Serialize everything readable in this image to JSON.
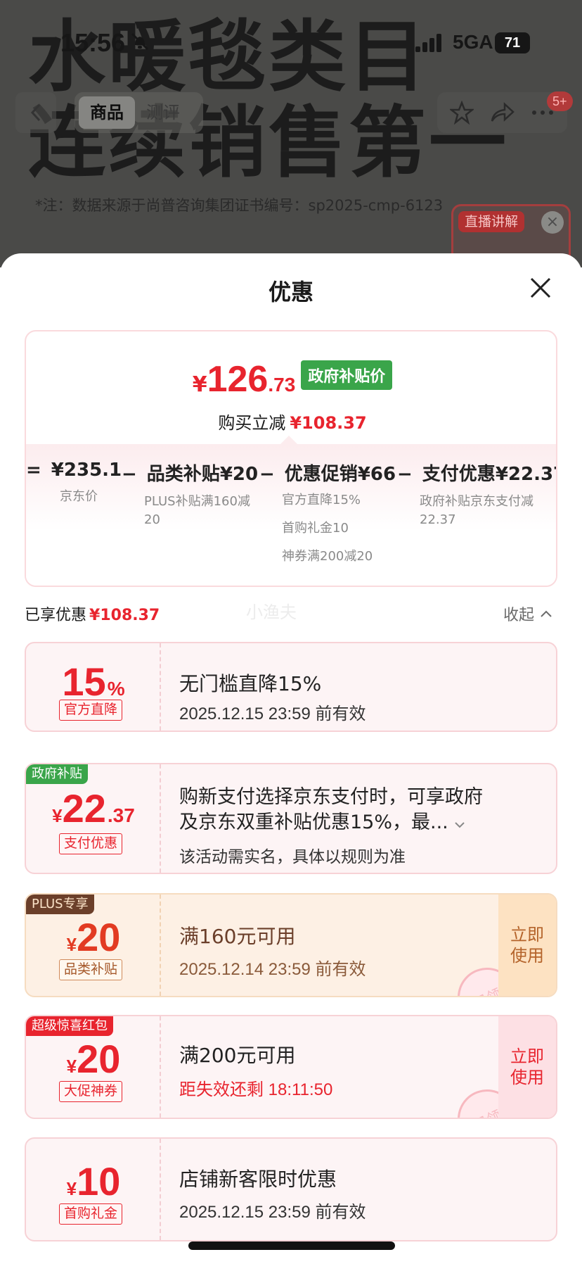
{
  "background": {
    "title_line1": "水暖毯类目",
    "title_line2": "连续销售第一",
    "note": "*注：数据来源于尚普咨询集团证书编号：sp2025-cmp-6123"
  },
  "status_bar": {
    "time": "15:56",
    "network": "5GA",
    "battery": "71"
  },
  "nav": {
    "tabs": [
      {
        "label": "商品"
      },
      {
        "label": "测评"
      }
    ],
    "badge": "5+"
  },
  "live": {
    "label": "直播讲解",
    "close": "×"
  },
  "sheet": {
    "title": "优惠"
  },
  "summary": {
    "currency": "¥",
    "price_int": "126",
    "price_dec": ".73",
    "price_tag": "政府补贴价",
    "instant_label": "购买立减",
    "instant_amount": "¥108.37",
    "formula": [
      {
        "op": "=",
        "amount": "¥235.1",
        "title": "",
        "desc": [
          "京东价"
        ]
      },
      {
        "op": "−",
        "amount": "¥20",
        "title": "品类补贴",
        "desc": [
          "PLUS补贴满160减20"
        ]
      },
      {
        "op": "−",
        "amount": "¥66",
        "title": "优惠促销",
        "desc": [
          "官方直降15%",
          "首购礼金10",
          "神券满200减20"
        ]
      },
      {
        "op": "−",
        "amount": "¥22.37",
        "title": "支付优惠",
        "desc": [
          "政府补贴京东支付减22.37"
        ]
      }
    ]
  },
  "enjoyed": {
    "label": "已享优惠",
    "amount": "¥108.37",
    "collapse": "收起",
    "watermark": "小渔夫"
  },
  "coupons": [
    {
      "corner": "",
      "cy": "",
      "num": "15",
      "suffix": "%",
      "tag": "官方直降",
      "main": "无门槛直降15%",
      "sub": "2025.12.15 23:59 前有效",
      "action": ""
    },
    {
      "corner": "政府补贴",
      "cy": "¥",
      "num": "22",
      "suffix": ".37",
      "tag": "支付优惠",
      "main": "购新支付选择京东支付时，可享政府",
      "main2": "及京东双重补贴优惠15%，最...",
      "sub": "该活动需实名，具体以规则为准",
      "action": ""
    },
    {
      "corner": "PLUS专享",
      "cy": "¥",
      "num": "20",
      "suffix": "",
      "tag": "品类补贴",
      "main": "满160元可用",
      "sub": "2025.12.14 23:59 前有效",
      "action": "立即使用",
      "stamp": "已领"
    },
    {
      "corner": "超级惊喜红包",
      "cy": "¥",
      "num": "20",
      "suffix": "",
      "tag": "大促神券",
      "main": "满200元可用",
      "sub": "距失效还剩 18:11:50",
      "action": "立即使用",
      "stamp": "已领"
    },
    {
      "corner": "",
      "cy": "¥",
      "num": "10",
      "suffix": "",
      "tag": "首购礼金",
      "main": "店铺新客限时优惠",
      "sub": "2025.12.15 23:59 前有效",
      "action": ""
    }
  ],
  "colors": {
    "accent_red": "#e8242e",
    "gov_green": "#3aa54a",
    "plus_brown": "#6b3f2a",
    "orange_text": "#b4632a"
  }
}
